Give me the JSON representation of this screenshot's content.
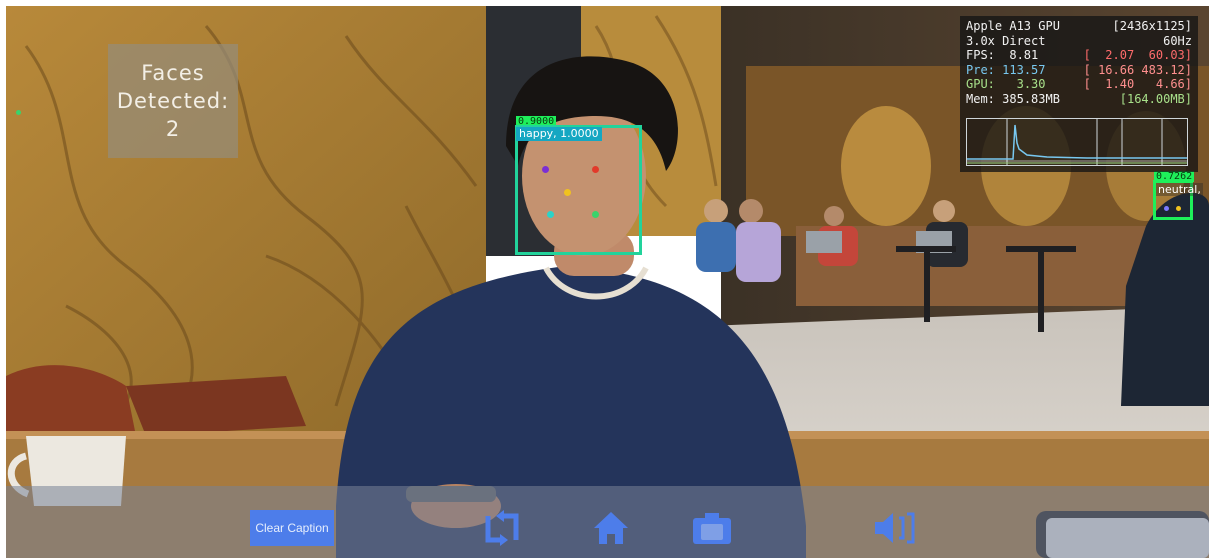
{
  "overlay": {
    "faces_label_line1": "Faces",
    "faces_label_line2": "Detected:",
    "faces_count": "2"
  },
  "faces": [
    {
      "confidence": "0.9000",
      "emotion": "happy, 1.0000"
    },
    {
      "confidence": "0.7262",
      "emotion": "neutral,"
    }
  ],
  "perf": {
    "gpu_name": "Apple A13 GPU",
    "resolution": "[2436x1125]",
    "mode": "3.0x Direct",
    "refresh": "60Hz",
    "fps_label": "FPS:",
    "fps_value": "8.81",
    "fps_range": "[  2.07  60.03]",
    "pre_label": "Pre:",
    "pre_value": "113.57",
    "pre_range": "[ 16.66 483.12]",
    "gpu_label": "GPU:",
    "gpu_value": "3.30",
    "gpu_range": "[  1.40   4.66]",
    "mem_label": "Mem:",
    "mem_value": "385.83MB",
    "mem_peak": "[164.00MB]"
  },
  "toolbar": {
    "clear_caption_label": "Clear Caption",
    "icons": [
      "switch-camera-icon",
      "home-icon",
      "camera-icon",
      "speaker-icon"
    ]
  },
  "colors": {
    "face_box": "#22d39b",
    "confidence_tag": "#1ef05a",
    "emotion_tag": "#15a7c2",
    "button_blue": "#4d7dea",
    "perf_pre": "#78c8f0",
    "perf_fps_range": "#ff6b6b",
    "perf_gpu": "#a8e08a"
  }
}
